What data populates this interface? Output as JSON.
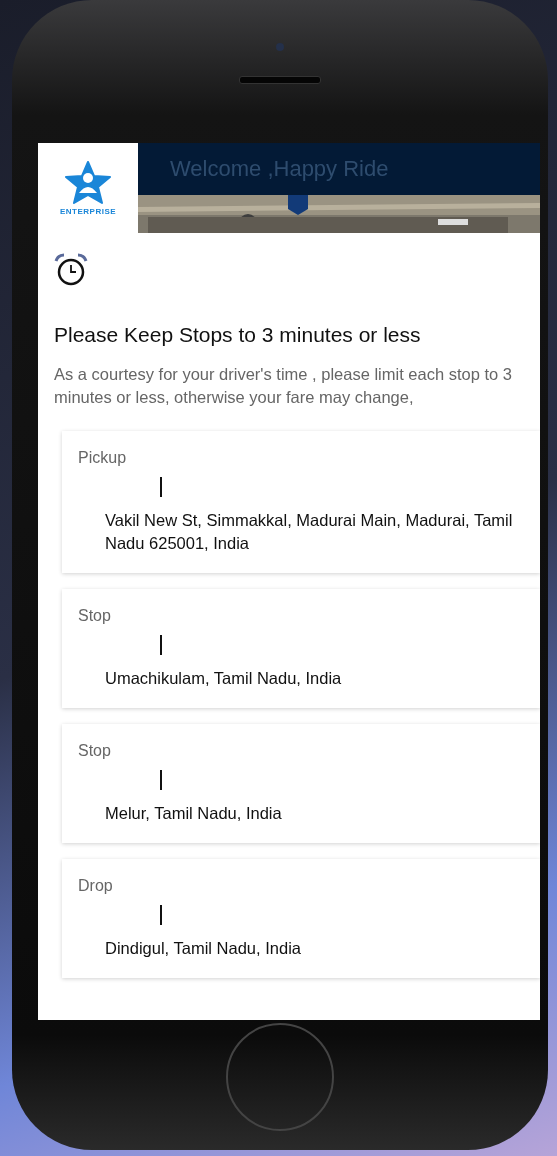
{
  "header": {
    "logo_text": "ENTERPRISE",
    "title": "Welcome ,Happy Ride"
  },
  "notice": {
    "heading": "Please Keep Stops to 3 minutes or less",
    "message": "As a courtesy for your driver's time , please limit each stop to 3 minutes or less, otherwise your fare may change,"
  },
  "stops": [
    {
      "label": "Pickup",
      "address": "Vakil New St, Simmakkal, Madurai Main, Madurai, Tamil Nadu 625001, India"
    },
    {
      "label": "Stop",
      "address": "Umachikulam, Tamil Nadu, India"
    },
    {
      "label": "Stop",
      "address": "Melur, Tamil Nadu, India"
    },
    {
      "label": "Drop",
      "address": "Dindigul, Tamil Nadu, India"
    }
  ]
}
